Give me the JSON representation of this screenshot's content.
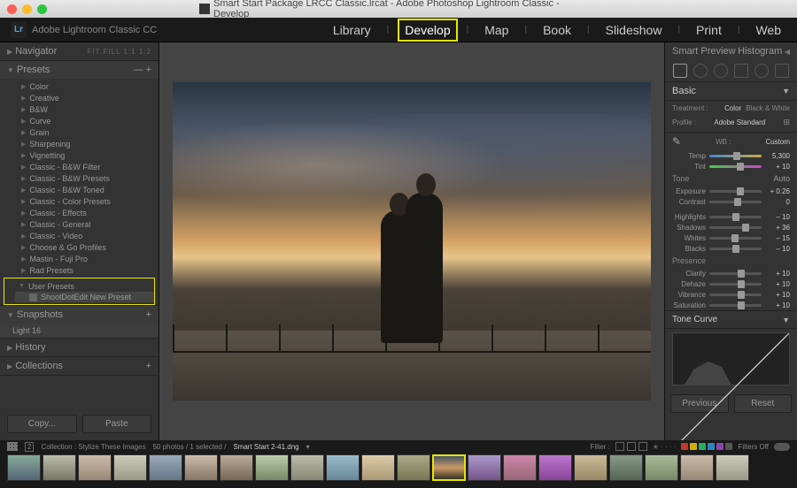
{
  "titlebar": {
    "title": "Smart Start Package LRCC Classic.lrcat - Adobe Photoshop Lightroom Classic - Develop"
  },
  "header": {
    "logo": "Lr",
    "product": "Adobe Lightroom Classic CC",
    "modules": [
      "Library",
      "Develop",
      "Map",
      "Book",
      "Slideshow",
      "Print",
      "Web"
    ],
    "active_module": "Develop"
  },
  "left": {
    "navigator": {
      "label": "Navigator",
      "modes": "FIT   FILL   1:1   1:2"
    },
    "presets_label": "Presets",
    "presets": [
      "Color",
      "Creative",
      "B&W",
      "Curve",
      "Grain",
      "Sharpening",
      "Vignetting",
      "Classic - B&W Filter",
      "Classic - B&W Presets",
      "Classic - B&W Toned",
      "Classic - Color Presets",
      "Classic - Effects",
      "Classic - General",
      "Classic - Video",
      "Choose & Go Profiles",
      "Mastin - Fuji Pro",
      "Rad Presets"
    ],
    "user_presets_label": "User Presets",
    "user_preset_item": "ShootDotEdit New Preset",
    "snapshots_label": "Snapshots",
    "snapshot_item": "Light 16",
    "history_label": "History",
    "collections_label": "Collections",
    "copy_btn": "Copy...",
    "paste_btn": "Paste"
  },
  "right": {
    "smart_preview": "Smart Preview",
    "histogram_label": "Histogram",
    "basic_label": "Basic",
    "treatment_label": "Treatment :",
    "treatment_color": "Color",
    "treatment_bw": "Black & White",
    "profile_label": "Profile :",
    "profile_value": "Adobe Standard",
    "wb_label": "WB :",
    "wb_value": "Custom",
    "tone_label": "Tone",
    "auto_label": "Auto",
    "presence_label": "Presence",
    "sliders": {
      "temp": {
        "label": "Temp",
        "value": "5,300"
      },
      "tint": {
        "label": "Tint",
        "value": "+ 10"
      },
      "exposure": {
        "label": "Exposure",
        "value": "+ 0.26"
      },
      "contrast": {
        "label": "Contrast",
        "value": "0"
      },
      "highlights": {
        "label": "Highlights",
        "value": "– 10"
      },
      "shadows": {
        "label": "Shadows",
        "value": "+ 36"
      },
      "whites": {
        "label": "Whites",
        "value": "– 15"
      },
      "blacks": {
        "label": "Blacks",
        "value": "– 10"
      },
      "clarity": {
        "label": "Clarity",
        "value": "+ 10"
      },
      "dehaze": {
        "label": "Dehaze",
        "value": "+ 10"
      },
      "vibrance": {
        "label": "Vibrance",
        "value": "+ 10"
      },
      "saturation": {
        "label": "Saturation",
        "value": "+ 10"
      }
    },
    "tonecurve_label": "Tone Curve",
    "previous_btn": "Previous",
    "reset_btn": "Reset"
  },
  "filmstrip": {
    "collection_label": "Collection : Stylize These Images",
    "count": "50 photos / 1 selected /",
    "filename": "Smart Start 2-41.dng",
    "filter_label": "Filter :",
    "filters_off": "Filters Off",
    "label_colors": [
      "#c0392b",
      "#d4ac0d",
      "#27ae60",
      "#2e86c1",
      "#8e44ad"
    ]
  }
}
